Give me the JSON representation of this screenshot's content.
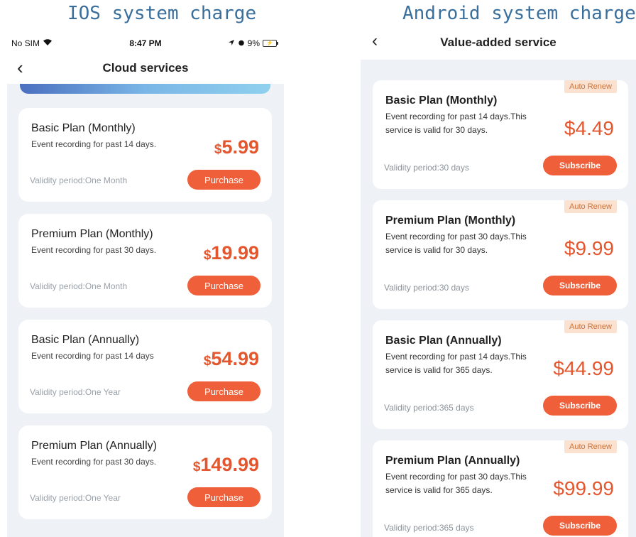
{
  "captions": {
    "ios": "IOS system charge",
    "android": "Android system charge"
  },
  "ios": {
    "status": {
      "carrier": "No SIM",
      "time": "8:47 PM",
      "battery": "9%"
    },
    "title": "Cloud services",
    "plans": [
      {
        "name": "Basic Plan (Monthly)",
        "desc": "Event recording for past 14 days.",
        "currency": "$",
        "amount": "5.99",
        "validity": "Validity period:One Month",
        "button": "Purchase"
      },
      {
        "name": "Premium Plan (Monthly)",
        "desc": "Event recording for past 30 days.",
        "currency": "$",
        "amount": "19.99",
        "validity": "Validity period:One Month",
        "button": "Purchase"
      },
      {
        "name": "Basic Plan (Annually)",
        "desc": "Event recording for past 14 days",
        "currency": "$",
        "amount": "54.99",
        "validity": "Validity period:One Year",
        "button": "Purchase"
      },
      {
        "name": "Premium Plan (Annually)",
        "desc": "Event recording for past 30 days.",
        "currency": "$",
        "amount": "149.99",
        "validity": "Validity period:One Year",
        "button": "Purchase"
      }
    ]
  },
  "android": {
    "title": "Value-added service",
    "plans": [
      {
        "badge": "Auto Renew",
        "name": "Basic Plan (Monthly)",
        "desc": "Event recording for past 14 days.This service is valid for 30 days.",
        "price": "$4.49",
        "validity": "Validity period:30 days",
        "button": "Subscribe"
      },
      {
        "badge": "Auto Renew",
        "name": "Premium Plan (Monthly)",
        "desc": "Event recording for past 30 days.This service is valid for 30 days.",
        "price": "$9.99",
        "validity": "Validity period:30 days",
        "button": "Subscribe"
      },
      {
        "badge": "Auto Renew",
        "name": "Basic Plan (Annually)",
        "desc": "Event recording for past 14 days.This service is valid for 365 days.",
        "price": "$44.99",
        "validity": "Validity period:365 days",
        "button": "Subscribe"
      },
      {
        "badge": "Auto Renew",
        "name": "Premium Plan (Annually)",
        "desc": "Event recording for past 30 days.This service is valid for 365 days.",
        "price": "$99.99",
        "validity": "Validity period:365 days",
        "button": "Subscribe"
      }
    ]
  },
  "icons": {
    "wifi": "wifi-icon",
    "location": "location-arrow-icon",
    "alarm": "alarm-icon",
    "battery": "battery-charging-icon",
    "back": "chevron-left-icon"
  },
  "colors": {
    "accent": "#ee5f3a",
    "price": "#e4572e",
    "badge_bg": "#fbe1cf",
    "page_bg": "#eef2f7",
    "caption": "#3a6f9c"
  }
}
